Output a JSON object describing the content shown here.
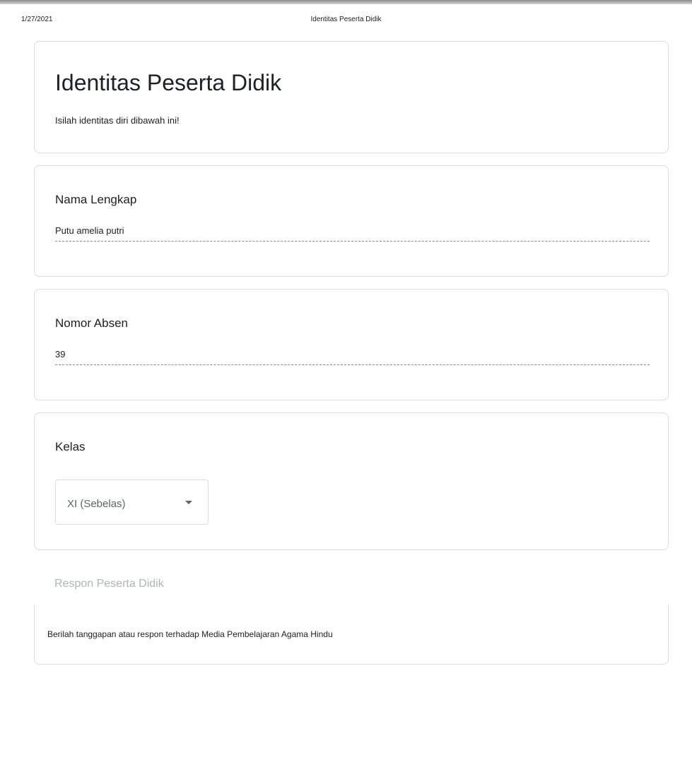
{
  "print_header": {
    "date": "1/27/2021",
    "title": "Identitas Peserta Didik"
  },
  "form": {
    "title": "Identitas Peserta Didik",
    "description": "Isilah identitas diri dibawah ini!"
  },
  "questions": [
    {
      "label": "Nama Lengkap",
      "answer": "Putu amelia putri"
    },
    {
      "label": "Nomor Absen",
      "answer": "39"
    },
    {
      "label": "Kelas",
      "selected_value": "XI (Sebelas)",
      "icon": "caret-down-icon"
    }
  ],
  "section": {
    "title": "Respon Peserta Didik",
    "description": "Berilah tanggapan atau respon terhadap Media Pembelajaran Agama Hindu"
  },
  "colors": {
    "text": "#202124",
    "border": "#dadce0",
    "muted": "#5f6368",
    "section_title": "#b0b3b8"
  }
}
